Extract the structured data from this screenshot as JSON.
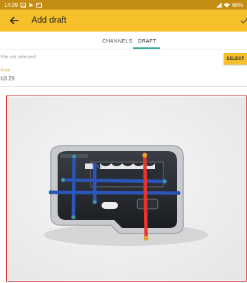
{
  "status_bar": {
    "time": "14:39",
    "battery": "68",
    "icons": [
      "image-icon",
      "play-icon",
      "gallery-icon",
      "signal-icon",
      "wifi-icon"
    ]
  },
  "app_bar": {
    "title": "Add draft",
    "back_icon": "arrow-left-icon",
    "confirm_icon": "check-icon"
  },
  "tabs": [
    {
      "label": "CHANNELS",
      "active": false
    },
    {
      "label": "DRAFT",
      "active": true
    }
  ],
  "file": {
    "label": "File not selected",
    "select_label": "SELECT"
  },
  "point": {
    "label": "Point",
    "value": "b3 29"
  },
  "image": {
    "marker_label": "b1",
    "line_colors": {
      "blue": "#2b55b8",
      "red": "#e8342c"
    }
  },
  "colors": {
    "accent": "#f5c02a",
    "status_bar": "#c48e14",
    "tab_indicator": "#23a394",
    "frame_border": "#e03535"
  }
}
